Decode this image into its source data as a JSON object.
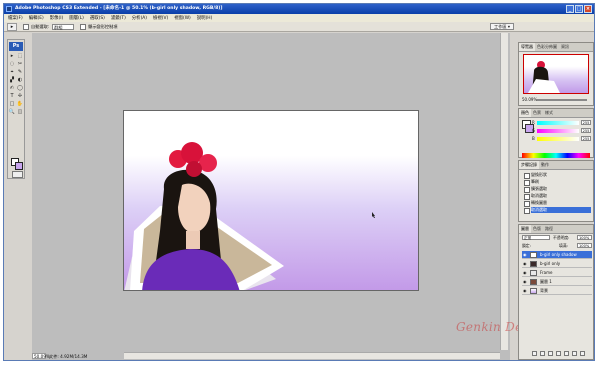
{
  "titlebar": {
    "title": "Adobe Photoshop CS3 Extended - [未命名-1 @ 50.1% (b-girl only shadow, RGB/8)]",
    "controls": [
      "_",
      "□",
      "×"
    ]
  },
  "menu": [
    "檔案(F)",
    "編輯(E)",
    "影像(I)",
    "圖層(L)",
    "選取(S)",
    "濾鏡(T)",
    "分析(A)",
    "檢視(V)",
    "視窗(W)",
    "說明(H)"
  ],
  "options": {
    "auto_select_label": "自動選取:",
    "auto_select_value": "群組",
    "transform_label": "顯示變形控制項",
    "workspace_label": "工作區 ▾"
  },
  "toolbox": {
    "logo": "Ps",
    "tools": [
      "▸",
      "⬚",
      "◌",
      "✂",
      "⌖",
      "✎",
      "▞",
      "◐",
      "✍",
      "◯",
      "T",
      "✢",
      "□",
      "✋",
      "🔍",
      "◫"
    ],
    "fg_color": "#ffffff",
    "bg_color": "#c9a6ef"
  },
  "status": {
    "zoom": "50.09%",
    "doc": "文件: 4.92M/14.3M"
  },
  "watermark": "Genkin Design",
  "navigator": {
    "tabs": [
      "導覽器",
      "色彩分佈圖",
      "資訊"
    ],
    "zoom": "50.09%"
  },
  "color_panel": {
    "tabs": [
      "顏色",
      "色票",
      "樣式"
    ],
    "channels": [
      {
        "label": "R",
        "value": "255"
      },
      {
        "label": "G",
        "value": "255"
      },
      {
        "label": "B",
        "value": "255"
      }
    ]
  },
  "history": {
    "tabs": [
      "步驟記錄",
      "動作"
    ],
    "items": [
      "變換形狀",
      "筆刷",
      "擴張選取",
      "取消選取",
      "轉換圖層",
      "取消選取"
    ],
    "selected_index": 5
  },
  "layers": {
    "tabs": [
      "圖層",
      "色版",
      "路徑"
    ],
    "blend_mode": "正常",
    "opacity_label": "不透明度:",
    "opacity": "100%",
    "lock_label": "鎖定:",
    "fill_label": "填滿:",
    "fill": "100%",
    "items": [
      {
        "name": "b-girl only shadow",
        "selected": true
      },
      {
        "name": "b-girl only",
        "selected": false
      },
      {
        "name": "Frame",
        "selected": false
      },
      {
        "name": "圖層 1",
        "selected": false
      },
      {
        "name": "背景",
        "selected": false
      }
    ]
  },
  "colors": {
    "title_blue": "#0a3fa8",
    "canvas_purple": "#c39ae8",
    "selection_blue": "#3a6fd8"
  }
}
